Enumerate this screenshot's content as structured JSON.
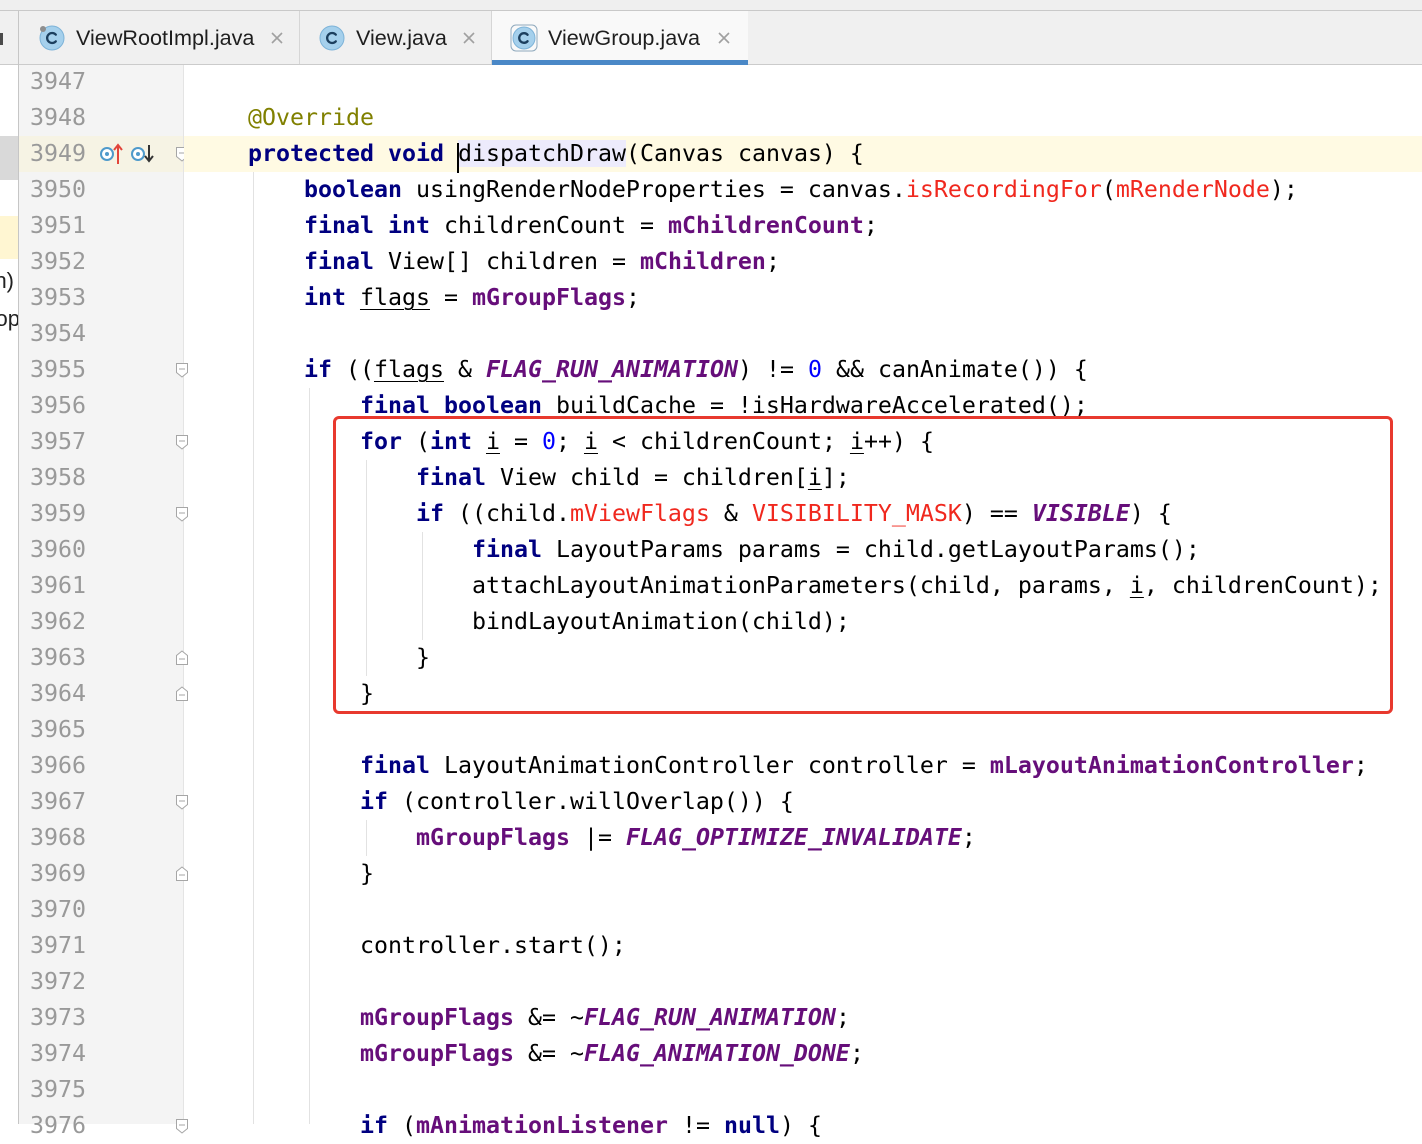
{
  "tab_accent": "#4A88C7",
  "tabs": [
    {
      "label": "ViewRootImpl.java",
      "icon": "java-class-icon",
      "active": false
    },
    {
      "label": "View.java",
      "icon": "java-class-icon",
      "active": false
    },
    {
      "label": "ViewGroup.java",
      "icon": "java-class-icon",
      "active": true
    }
  ],
  "side_panel": {
    "fragments": [
      "n)",
      "op"
    ]
  },
  "annotation_box": {
    "color": "#E8392E"
  },
  "editor": {
    "colors": {
      "text": "#000000",
      "keyword": "#000080",
      "annotation": "#808000",
      "field": "#660E7A",
      "unresolved": "#F0281E",
      "number": "#0000FF",
      "line_number": "#999999",
      "current_line": "#FFFAE3",
      "identifier_under_caret": "#EDEBFC"
    },
    "lines": [
      {
        "num": "3947",
        "tokens": []
      },
      {
        "num": "3948",
        "tokens": [
          {
            "p": "    "
          },
          {
            "an": "@Override"
          }
        ]
      },
      {
        "num": "3949",
        "current": true,
        "gutter_icons": [
          "overrides-method-icon",
          "overridden-method-icon"
        ],
        "fold": "fold-open-icon",
        "tokens": [
          {
            "p": "    "
          },
          {
            "kw": "protected"
          },
          {
            "p": " "
          },
          {
            "kw": "void"
          },
          {
            "p": " "
          },
          {
            "md": "dispatchDraw"
          },
          {
            "p": "(Canvas canvas) {"
          }
        ]
      },
      {
        "num": "3950",
        "tokens": [
          {
            "p": "        "
          },
          {
            "kw": "boolean"
          },
          {
            "p": " usingRenderNodeProperties = canvas."
          },
          {
            "er": "isRecordingFor"
          },
          {
            "p": "("
          },
          {
            "er": "mRenderNode"
          },
          {
            "p": ");"
          }
        ]
      },
      {
        "num": "3951",
        "tokens": [
          {
            "p": "        "
          },
          {
            "kw": "final"
          },
          {
            "p": " "
          },
          {
            "kw": "int"
          },
          {
            "p": " childrenCount = "
          },
          {
            "fd": "mChildrenCount"
          },
          {
            "p": ";"
          }
        ]
      },
      {
        "num": "3952",
        "tokens": [
          {
            "p": "        "
          },
          {
            "kw": "final"
          },
          {
            "p": " View[] children = "
          },
          {
            "fd": "mChildren"
          },
          {
            "p": ";"
          }
        ]
      },
      {
        "num": "3953",
        "tokens": [
          {
            "p": "        "
          },
          {
            "kw": "int"
          },
          {
            "p": " "
          },
          {
            "lv": "flags"
          },
          {
            "p": " = "
          },
          {
            "fd": "mGroupFlags"
          },
          {
            "p": ";"
          }
        ]
      },
      {
        "num": "3954",
        "tokens": []
      },
      {
        "num": "3955",
        "fold": "fold-open-icon",
        "tokens": [
          {
            "p": "        "
          },
          {
            "kw": "if"
          },
          {
            "p": " (("
          },
          {
            "lv": "flags"
          },
          {
            "p": " & "
          },
          {
            "st": "FLAG_RUN_ANIMATION"
          },
          {
            "p": ") != "
          },
          {
            "nm": "0"
          },
          {
            "p": " && canAnimate()) {"
          }
        ]
      },
      {
        "num": "3956",
        "tokens": [
          {
            "p": "            "
          },
          {
            "kw": "final"
          },
          {
            "p": " "
          },
          {
            "kw": "boolean"
          },
          {
            "p": " buildCache = !isHardwareAccelerated();"
          }
        ]
      },
      {
        "num": "3957",
        "fold": "fold-open-icon",
        "tokens": [
          {
            "p": "            "
          },
          {
            "kw": "for"
          },
          {
            "p": " ("
          },
          {
            "kw": "int"
          },
          {
            "p": " "
          },
          {
            "lv": "i"
          },
          {
            "p": " = "
          },
          {
            "nm": "0"
          },
          {
            "p": "; "
          },
          {
            "lv": "i"
          },
          {
            "p": " < childrenCount; "
          },
          {
            "lv": "i"
          },
          {
            "p": "++) {"
          }
        ]
      },
      {
        "num": "3958",
        "tokens": [
          {
            "p": "                "
          },
          {
            "kw": "final"
          },
          {
            "p": " View child = children["
          },
          {
            "lv": "i"
          },
          {
            "p": "];"
          }
        ]
      },
      {
        "num": "3959",
        "fold": "fold-open-icon",
        "tokens": [
          {
            "p": "                "
          },
          {
            "kw": "if"
          },
          {
            "p": " ((child."
          },
          {
            "er": "mViewFlags"
          },
          {
            "p": " & "
          },
          {
            "er": "VISIBILITY_MASK"
          },
          {
            "p": ") == "
          },
          {
            "st": "VISIBLE"
          },
          {
            "p": ") {"
          }
        ]
      },
      {
        "num": "3960",
        "tokens": [
          {
            "p": "                    "
          },
          {
            "kw": "final"
          },
          {
            "p": " LayoutParams params = child.getLayoutParams();"
          }
        ]
      },
      {
        "num": "3961",
        "tokens": [
          {
            "p": "                    attachLayoutAnimationParameters(child, params, "
          },
          {
            "lv": "i"
          },
          {
            "p": ", childrenCount);"
          }
        ]
      },
      {
        "num": "3962",
        "tokens": [
          {
            "p": "                    bindLayoutAnimation(child);"
          }
        ]
      },
      {
        "num": "3963",
        "fold": "fold-close-icon",
        "tokens": [
          {
            "p": "                }"
          }
        ]
      },
      {
        "num": "3964",
        "fold": "fold-close-icon",
        "tokens": [
          {
            "p": "            }"
          }
        ]
      },
      {
        "num": "3965",
        "tokens": []
      },
      {
        "num": "3966",
        "tokens": [
          {
            "p": "            "
          },
          {
            "kw": "final"
          },
          {
            "p": " LayoutAnimationController controller = "
          },
          {
            "fd": "mLayoutAnimationController"
          },
          {
            "p": ";"
          }
        ]
      },
      {
        "num": "3967",
        "fold": "fold-open-icon",
        "tokens": [
          {
            "p": "            "
          },
          {
            "kw": "if"
          },
          {
            "p": " (controller.willOverlap()) {"
          }
        ]
      },
      {
        "num": "3968",
        "tokens": [
          {
            "p": "                "
          },
          {
            "fd": "mGroupFlags"
          },
          {
            "p": " |= "
          },
          {
            "st": "FLAG_OPTIMIZE_INVALIDATE"
          },
          {
            "p": ";"
          }
        ]
      },
      {
        "num": "3969",
        "fold": "fold-close-icon",
        "tokens": [
          {
            "p": "            }"
          }
        ]
      },
      {
        "num": "3970",
        "tokens": []
      },
      {
        "num": "3971",
        "tokens": [
          {
            "p": "            controller.start();"
          }
        ]
      },
      {
        "num": "3972",
        "tokens": []
      },
      {
        "num": "3973",
        "tokens": [
          {
            "p": "            "
          },
          {
            "fd": "mGroupFlags"
          },
          {
            "p": " &= ~"
          },
          {
            "st": "FLAG_RUN_ANIMATION"
          },
          {
            "p": ";"
          }
        ]
      },
      {
        "num": "3974",
        "tokens": [
          {
            "p": "            "
          },
          {
            "fd": "mGroupFlags"
          },
          {
            "p": " &= ~"
          },
          {
            "st": "FLAG_ANIMATION_DONE"
          },
          {
            "p": ";"
          }
        ]
      },
      {
        "num": "3975",
        "tokens": []
      },
      {
        "num": "3976",
        "fold": "fold-open-icon",
        "tokens": [
          {
            "p": "            "
          },
          {
            "kw": "if"
          },
          {
            "p": " ("
          },
          {
            "fd": "mAnimationListener"
          },
          {
            "p": " != "
          },
          {
            "kw": "null"
          },
          {
            "p": ") {"
          }
        ]
      }
    ]
  }
}
